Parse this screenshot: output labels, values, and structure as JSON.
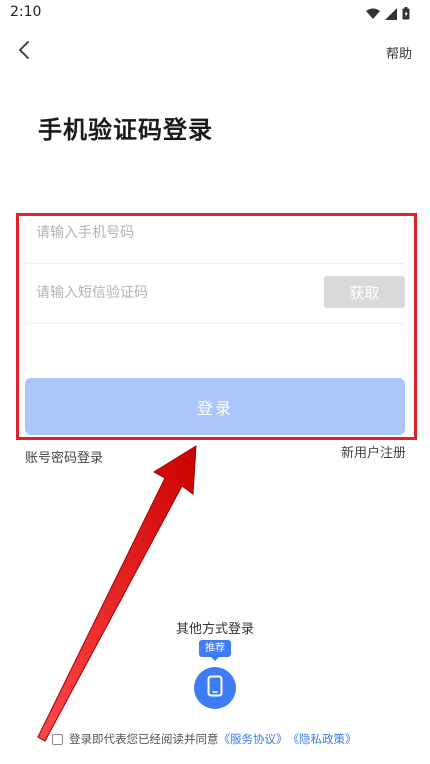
{
  "status_bar": {
    "time": "2:10"
  },
  "header": {
    "help_label": "帮助"
  },
  "page": {
    "title": "手机验证码登录"
  },
  "form": {
    "phone_placeholder": "请输入手机号码",
    "sms_placeholder": "请输入短信验证码",
    "get_code_label": "获取",
    "login_label": "登录"
  },
  "links": {
    "password_login": "账号密码登录",
    "register": "新用户注册"
  },
  "other_login": {
    "title": "其他方式登录",
    "badge": "推荐"
  },
  "agreement": {
    "text": "登录即代表您已经阅读并同意",
    "service": "《服务协议》",
    "privacy": "《隐私政策》"
  },
  "colors": {
    "primary": "#3d7cf5",
    "login_disabled": "#aac6fa",
    "highlight": "#e0212a"
  }
}
